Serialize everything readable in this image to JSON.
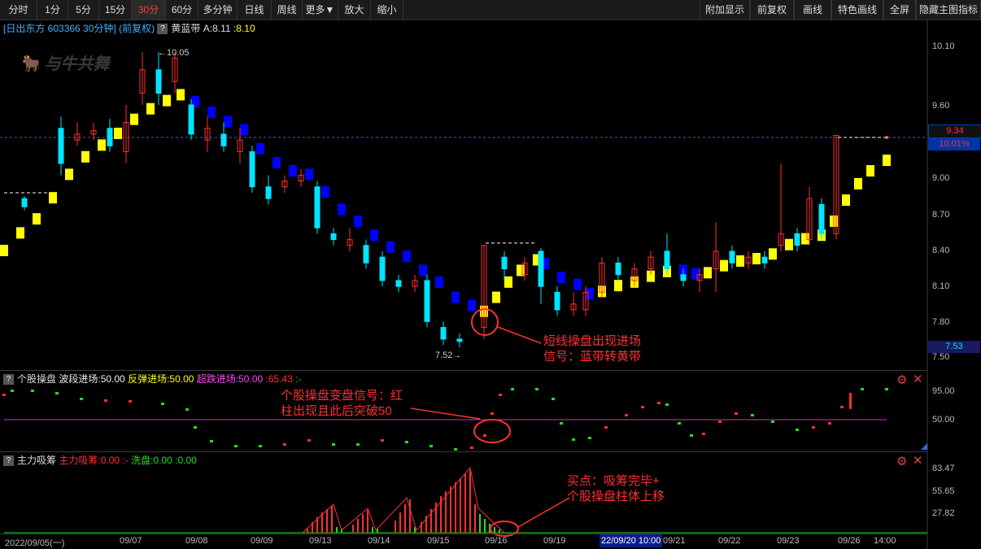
{
  "toolbar": {
    "left": [
      "分时",
      "1分",
      "5分",
      "15分",
      "30分",
      "60分",
      "多分钟",
      "日线",
      "周线",
      "更多▼",
      "放大",
      "缩小"
    ],
    "active": "30分",
    "right": [
      "附加显示",
      "前复权",
      "画线",
      "特色画线",
      "全屏",
      "隐藏主图指标"
    ]
  },
  "main_header": {
    "stock": "[日出东方 603366 30分钟]",
    "adj": "(前复权)",
    "indicator": "黄蓝带",
    "a_label": "A:8.11",
    "b_label": ":8.10"
  },
  "watermark": "与牛共舞",
  "price_axis": [
    "10.10",
    "9.60",
    "9.00",
    "8.70",
    "8.40",
    "8.10",
    "7.80",
    "7.50"
  ],
  "last_price_tag": "9.34",
  "pct_tag": "10.01%",
  "low_tag": "7.53",
  "high_label": "10.05",
  "low_label": "7.52",
  "annotation_main": [
    "短线操盘出现进场",
    "信号：蓝带转黄带"
  ],
  "panel2": {
    "title": "个股操盘",
    "l1": "波段进场:50.00",
    "l2": "反弹进场:50.00",
    "l3": "超跌进场:50.00",
    "l4": ":65.43",
    "l5": ":-",
    "axis": [
      "95.00",
      "50.00"
    ],
    "annotation": [
      "个股操盘变盘信号：红",
      "柱出现且此后突破50"
    ]
  },
  "panel3": {
    "title": "主力吸筹",
    "l1": "主力吸筹:0.00",
    "l2": ":-",
    "l3": "洗盘:0.00",
    "l4": ":0.00",
    "axis": [
      "83.47",
      "55.65",
      "27.82"
    ],
    "annotation": [
      "买点：吸筹完毕+",
      "个股操盘柱体上移"
    ]
  },
  "x_axis": {
    "first": "2022/09/05(一)",
    "labels": [
      "09/07",
      "09/08",
      "09/09",
      "09/13",
      "09/14",
      "09/15",
      "09/16",
      "09/19",
      "09/21",
      "09/22",
      "09/23",
      "09/26",
      "14:00"
    ],
    "cursor": "22/09/20 10:00"
  },
  "colors": {
    "up": "#ff3030",
    "down": "#00e5ff",
    "yellow": "#ffff00",
    "blue": "#0000ff",
    "green": "#22dd22",
    "magenta": "#cc33cc"
  }
}
